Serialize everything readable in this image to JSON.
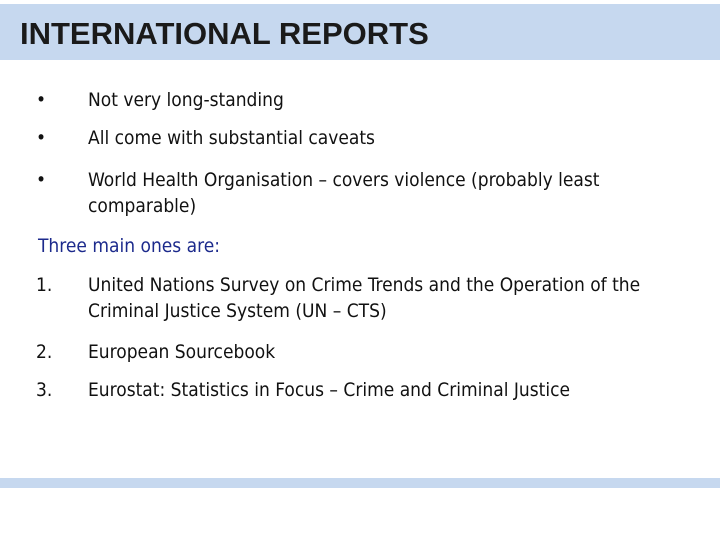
{
  "slide": {
    "title": "INTERNATIONAL REPORTS"
  },
  "bullets": [
    {
      "marker": "•",
      "text": "Not very long-standing"
    },
    {
      "marker": "•",
      "text": "All come with substantial caveats"
    },
    {
      "marker": "•",
      "text": "World Health Organisation – covers violence (probably least comparable)"
    }
  ],
  "intro": "Three main ones are:",
  "numbered": [
    {
      "marker": "1.",
      "text": "United Nations Survey on Crime Trends and the Operation of the Criminal Justice System (UN – CTS)"
    },
    {
      "marker": "2.",
      "text": "European Sourcebook"
    },
    {
      "marker": "3.",
      "text": "Eurostat: Statistics in Focus – Crime and Criminal Justice"
    }
  ],
  "colors": {
    "title_bar": "#c6d8ef",
    "intro_text": "#1c2a8c",
    "body_text": "#111111"
  }
}
